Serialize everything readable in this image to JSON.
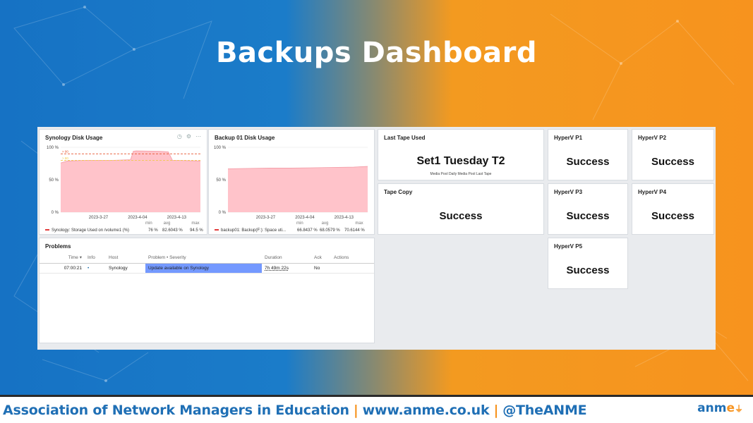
{
  "slide": {
    "title": "Backups Dashboard",
    "footer": {
      "org": "Association of Network Managers in Education",
      "separator": "|",
      "website": "www.anme.co.uk",
      "handle": "@TheANME",
      "logo_main": "anm",
      "logo_accent": "e"
    }
  },
  "colors": {
    "bg_blue": "#1672c4",
    "bg_orange": "#f7931e",
    "series_fill": "#ffc0c7",
    "series_line": "#e23a3a",
    "threshold_red": "#e6522c",
    "threshold_yellow": "#f2c94c",
    "severity_info": "#7499ff"
  },
  "panels": {
    "synology": {
      "title": "Synology Disk Usage",
      "tools": [
        "history-icon",
        "gear-icon",
        "more-icon"
      ],
      "tool_glyphs": [
        "◷",
        "⚙",
        "⋯"
      ],
      "legend": "Synology: Storage Used on /volume1 (%)",
      "stats": {
        "headers": [
          "min",
          "avg",
          "max"
        ],
        "values": [
          "76 %",
          "82.6043 %",
          "94.5 %"
        ]
      }
    },
    "backup01": {
      "title": "Backup 01 Disk Usage",
      "legend": "backup01: Backup(F:): Space uti...",
      "stats": {
        "headers": [
          "min",
          "avg",
          "max"
        ],
        "values": [
          "66.8437 %",
          "68.0579 %",
          "70.6144 %"
        ]
      }
    },
    "last_tape": {
      "title": "Last Tape Used",
      "value": "Set1 Tuesday T2",
      "subtitle": "Media Pool Daily Media Pool Last Tape"
    },
    "tape_copy": {
      "title": "Tape Copy",
      "value": "Success"
    },
    "hyperv": [
      {
        "title": "HyperV P1",
        "value": "Success"
      },
      {
        "title": "HyperV P2",
        "value": "Success"
      },
      {
        "title": "HyperV P3",
        "value": "Success"
      },
      {
        "title": "HyperV P4",
        "value": "Success"
      },
      {
        "title": "HyperV P5",
        "value": "Success"
      }
    ],
    "problems": {
      "title": "Problems",
      "columns": [
        "Time ▾",
        "Info",
        "Host",
        "Problem • Severity",
        "Duration",
        "Ack",
        "Actions"
      ],
      "rows": [
        {
          "time": "07:00:21",
          "info": "•",
          "host": "Synology",
          "problem": "Update available on Synology",
          "duration": "7h 49m 22s",
          "ack": "No",
          "actions": ""
        }
      ]
    }
  },
  "chart_data": [
    {
      "type": "area",
      "title": "Synology Disk Usage",
      "x_ticks": [
        "2023-3-27",
        "2023-4-04",
        "2023-4-13"
      ],
      "y_ticks": [
        "100 %",
        "50 %",
        "0 %"
      ],
      "ylim": [
        0,
        100
      ],
      "thresholds": [
        {
          "label": "> 90",
          "value": 90,
          "color": "#e6522c"
        },
        {
          "label": "> 80",
          "value": 80,
          "color": "#f2c94c"
        }
      ],
      "series": [
        {
          "name": "Synology: Storage Used on /volume1 (%)",
          "x": [
            0,
            0.05,
            0.2,
            0.38,
            0.5,
            0.52,
            0.54,
            0.7,
            0.77,
            0.8,
            1.0
          ],
          "values": [
            76,
            79,
            80,
            80,
            81,
            94,
            94.5,
            94,
            93,
            80,
            79
          ]
        }
      ]
    },
    {
      "type": "area",
      "title": "Backup 01 Disk Usage",
      "x_ticks": [
        "2023-3-27",
        "2023-4-04",
        "2023-4-13"
      ],
      "y_ticks": [
        "100 %",
        "50 %",
        "0 %"
      ],
      "ylim": [
        0,
        100
      ],
      "series": [
        {
          "name": "backup01: Backup(F:): Space uti...",
          "x": [
            0,
            0.15,
            0.3,
            0.45,
            0.6,
            0.75,
            0.9,
            1.0
          ],
          "values": [
            67,
            67.5,
            68,
            68,
            68.5,
            69,
            69.5,
            70.6
          ]
        }
      ]
    }
  ]
}
